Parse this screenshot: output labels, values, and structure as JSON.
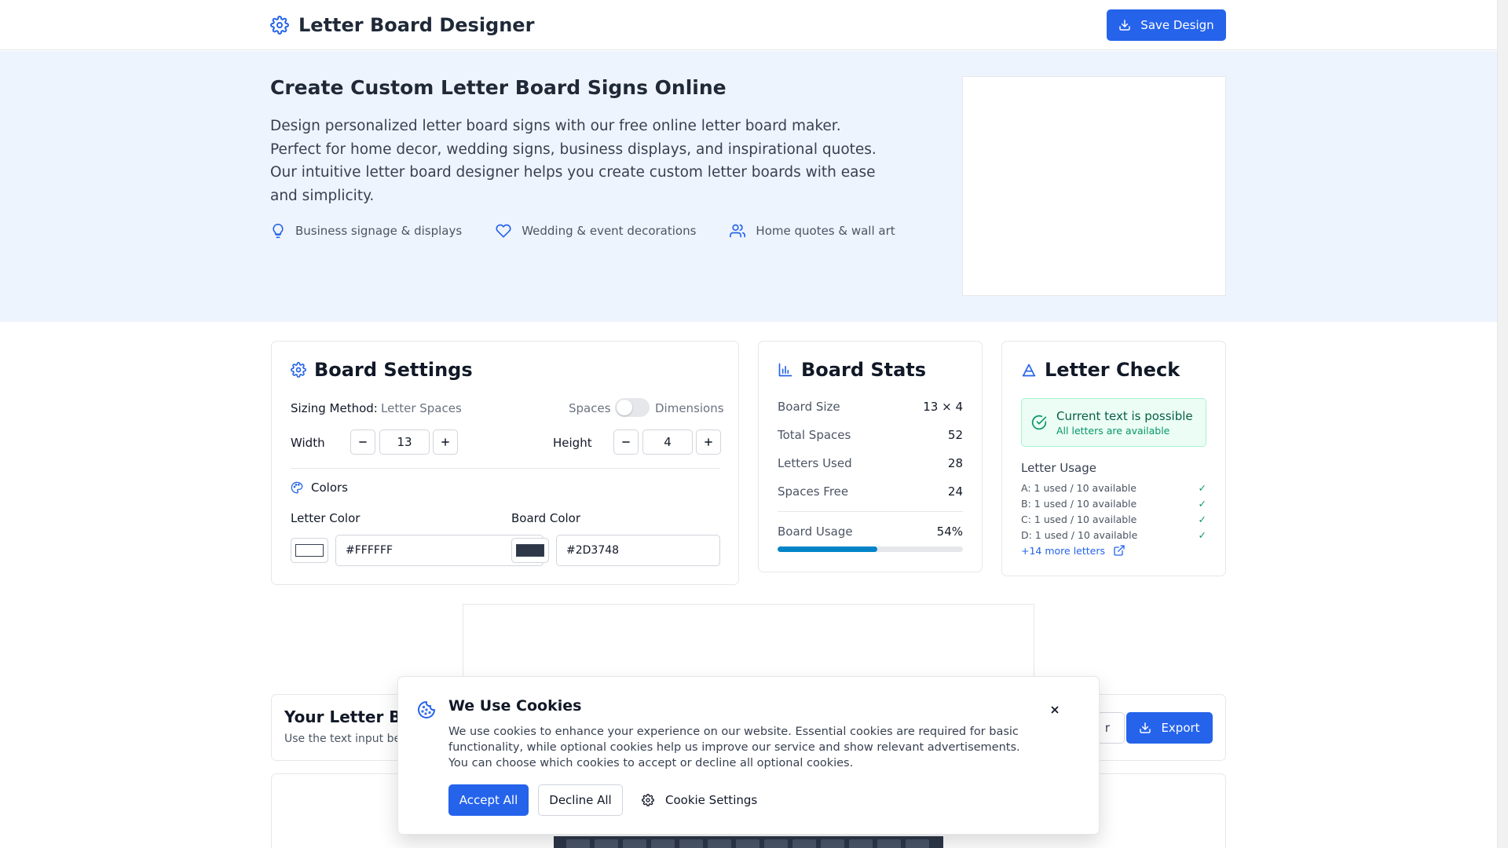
{
  "header": {
    "title": "Letter Board Designer",
    "logo_icon": "gear-icon",
    "save_label": "Save Design",
    "save_icon": "download-icon"
  },
  "hero": {
    "title": "Create Custom Letter Board Signs Online",
    "description": "Design personalized letter board signs with our free online letter board maker. Perfect for home decor, wedding signs, business displays, and inspirational quotes. Our intuitive letter board designer helps you create custom letter boards with ease and simplicity.",
    "features": [
      {
        "icon": "lightbulb-icon",
        "label": "Business signage & displays"
      },
      {
        "icon": "heart-icon",
        "label": "Wedding & event decorations"
      },
      {
        "icon": "users-icon",
        "label": "Home quotes & wall art"
      }
    ]
  },
  "settings": {
    "title": "Board Settings",
    "sizing_label": "Sizing Method:",
    "sizing_value": "Letter Spaces",
    "toggle_left": "Spaces",
    "toggle_right": "Dimensions",
    "width_label": "Width",
    "width_value": "13",
    "height_label": "Height",
    "height_value": "4",
    "colors_label": "Colors",
    "letter_color_label": "Letter Color",
    "letter_color_value": "#FFFFFF",
    "board_color_label": "Board Color",
    "board_color_value": "#2D3748"
  },
  "stats": {
    "title": "Board Stats",
    "rows": [
      {
        "label": "Board Size",
        "value": "13 × 4"
      },
      {
        "label": "Total Spaces",
        "value": "52"
      },
      {
        "label": "Letters Used",
        "value": "28"
      },
      {
        "label": "Spaces Free",
        "value": "24"
      }
    ],
    "usage_label": "Board Usage",
    "usage_value": "54%",
    "usage_fraction": 0.54,
    "accent": "#0284c7"
  },
  "check": {
    "title": "Letter Check",
    "status_title": "Current text is possible",
    "status_sub": "All letters are available",
    "usage_heading": "Letter Usage",
    "letters": [
      {
        "text": "A: 1 used / 10 available",
        "mark": "✓"
      },
      {
        "text": "B: 1 used / 10 available",
        "mark": "✓"
      },
      {
        "text": "C: 1 used / 10 available",
        "mark": "✓"
      },
      {
        "text": "D: 1 used / 10 available",
        "mark": "✓"
      }
    ],
    "more_label": "+14 more letters"
  },
  "board": {
    "title": "Your Letter B",
    "subtitle": "Use the text input be",
    "partial_button": "r",
    "export_label": "Export"
  },
  "cookie": {
    "title": "We Use Cookies",
    "text": "We use cookies to enhance your experience on our website. Essential cookies are required for basic functionality, while optional cookies help us improve our service and show relevant advertisements. You can choose which cookies to accept or decline all optional cookies.",
    "accept": "Accept All",
    "decline": "Decline All",
    "settings": "Cookie Settings"
  },
  "colors": {
    "primary": "#2563eb",
    "hero_bg": "#eef4fd",
    "board": "#2d3748",
    "success": "#059669"
  }
}
